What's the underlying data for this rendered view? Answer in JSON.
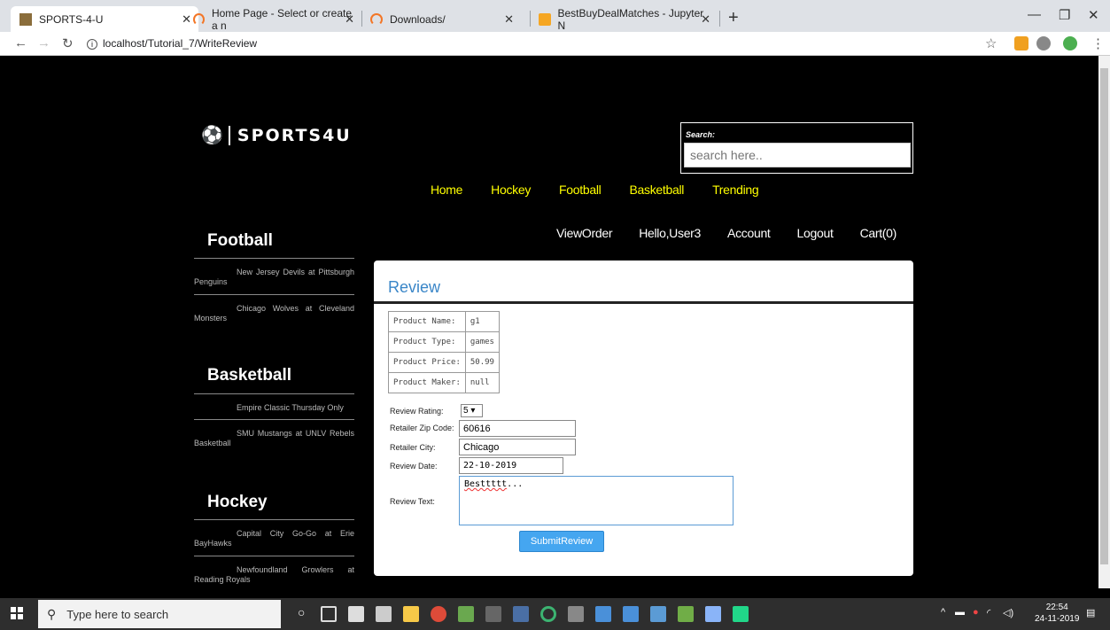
{
  "browser": {
    "tabs": [
      {
        "title": "SPORTS-4-U"
      },
      {
        "title": "Home Page - Select or create a n"
      },
      {
        "title": "Downloads/"
      },
      {
        "title": "BestBuyDealMatches - Jupyter N"
      }
    ],
    "new_tab": "+",
    "url": "localhost/Tutorial_7/WriteReview"
  },
  "site": {
    "logo_text": "SPORTS4U",
    "search": {
      "label": "Search:",
      "placeholder": "search here.."
    },
    "main_nav": [
      "Home",
      "Hockey",
      "Football",
      "Basketball",
      "Trending"
    ],
    "user_nav": [
      "ViewOrder",
      "Hello,User3",
      "Account",
      "Logout",
      "Cart(0)"
    ]
  },
  "sidebar": {
    "sections": [
      {
        "heading": "Football",
        "items": [
          "New Jersey Devils at Pittsburgh Penguins",
          "Chicago Wolves at Cleveland Monsters"
        ]
      },
      {
        "heading": "Basketball",
        "items": [
          "Empire Classic Thursday Only",
          "SMU Mustangs at UNLV Rebels Basketball"
        ]
      },
      {
        "heading": "Hockey",
        "items": [
          "Capital City Go-Go at Erie BayHawks",
          "Newfoundland Growlers at Reading Royals"
        ]
      }
    ]
  },
  "review": {
    "title": "Review",
    "product": [
      {
        "label": "Product Name:",
        "value": "g1"
      },
      {
        "label": "Product Type:",
        "value": "games"
      },
      {
        "label": "Product Price:",
        "value": "50.99"
      },
      {
        "label": "Product Maker:",
        "value": "null"
      }
    ],
    "rating_label": "Review Rating:",
    "rating_value": "5",
    "zip_label": "Retailer Zip Code:",
    "zip_value": "60616",
    "city_label": "Retailer City:",
    "city_value": "Chicago",
    "date_label": "Review Date:",
    "date_value": "22-10-2019",
    "text_label": "Review Text:",
    "text_value": "Besttttt",
    "text_suffix": "...",
    "submit_label": "SubmitReview"
  },
  "taskbar": {
    "search_placeholder": "Type here to search",
    "time": "22:54",
    "date": "24-11-2019"
  },
  "colors": {
    "nav_yellow": "#ffff00",
    "review_blue": "#3a86c8",
    "submit_blue": "#45a6f0"
  }
}
